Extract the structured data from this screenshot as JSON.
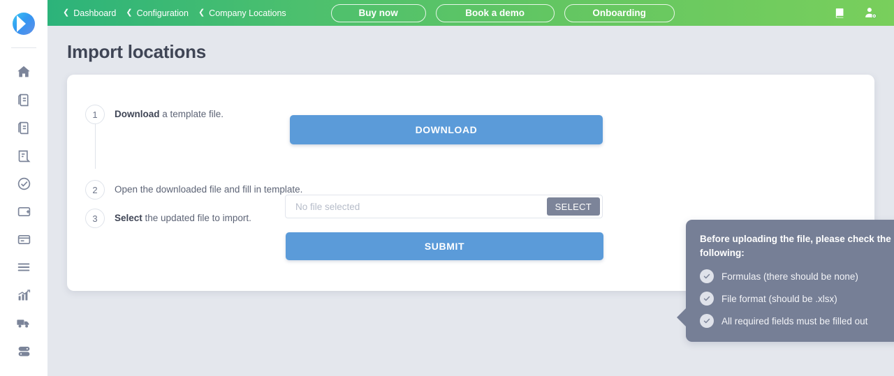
{
  "sidebar": {
    "logo_name": "app-logo",
    "items": [
      {
        "icon": "home-icon",
        "label": "Home"
      },
      {
        "icon": "document-icon",
        "label": "Documents"
      },
      {
        "icon": "document-alt-icon",
        "label": "Documents Alt"
      },
      {
        "icon": "receipt-icon",
        "label": "Receipts"
      },
      {
        "icon": "check-circle-icon",
        "label": "Approvals"
      },
      {
        "icon": "wallet-icon",
        "label": "Wallet"
      },
      {
        "icon": "card-icon",
        "label": "Cards"
      },
      {
        "icon": "list-icon",
        "label": "Lists"
      },
      {
        "icon": "chart-icon",
        "label": "Reports"
      },
      {
        "icon": "truck-icon",
        "label": "Shipping"
      },
      {
        "icon": "server-icon",
        "label": "Server"
      }
    ]
  },
  "topbar": {
    "breadcrumb": [
      {
        "chevron": "❮",
        "label": "Dashboard"
      },
      {
        "chevron": "❮",
        "label": "Configuration"
      },
      {
        "chevron": "❮",
        "label": "Company Locations"
      }
    ],
    "actions": [
      {
        "label": "Buy now"
      },
      {
        "label": "Book a demo"
      },
      {
        "label": "Onboarding"
      }
    ],
    "right_icons": [
      {
        "icon": "manual-book-icon"
      },
      {
        "icon": "user-settings-icon"
      }
    ],
    "gradient_from": "#2cb37a",
    "gradient_to": "#79cf5c"
  },
  "page": {
    "title": "Import locations"
  },
  "steps": [
    {
      "number": "1",
      "text_bold": "Download",
      "text_rest": " a template file."
    },
    {
      "number": "2",
      "text_bold": "",
      "text_rest": "Open the downloaded file and fill in template."
    },
    {
      "number": "3",
      "text_bold": "Select",
      "text_rest": " the updated file to import."
    }
  ],
  "form": {
    "download_label": "DOWNLOAD",
    "file_placeholder": "No file selected",
    "select_label": "SELECT",
    "submit_label": "SUBMIT",
    "primary_color": "#5b9bd9",
    "select_color": "#7c8499"
  },
  "tooltip": {
    "title": "Before uploading the file, please check the following:",
    "items": [
      {
        "check_icon": "check-circle-icon",
        "label": "Formulas (there should be none)"
      },
      {
        "check_icon": "check-circle-icon",
        "label": "File format (should be .xlsx)"
      },
      {
        "check_icon": "check-circle-icon",
        "label": "All required fields must be filled out"
      }
    ],
    "background_color": "#767f96"
  }
}
